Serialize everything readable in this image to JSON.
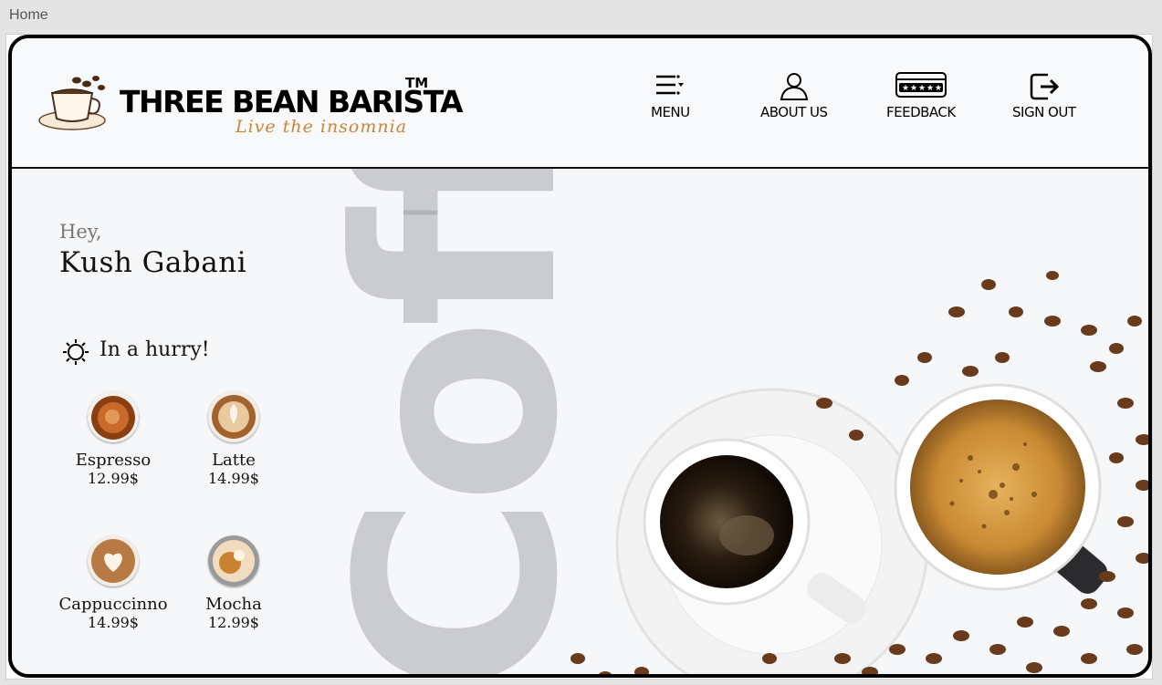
{
  "window": {
    "title": "Home"
  },
  "brand": {
    "name": "THREE BEAN BARISTA",
    "tm": "TM",
    "tagline": "Live the insomnia"
  },
  "nav": [
    {
      "label": "MENU",
      "icon": "menu-icon"
    },
    {
      "label": "ABOUT US",
      "icon": "person-icon"
    },
    {
      "label": "FEEDBACK",
      "icon": "rating-stars-icon"
    },
    {
      "label": "SIGN OUT",
      "icon": "sign-out-icon"
    }
  ],
  "watermark": "Coffee",
  "greeting": {
    "hey": "Hey,",
    "name": "Kush Gabani"
  },
  "quick": {
    "title": "In a hurry!",
    "icon": "sun-icon",
    "products": [
      {
        "name": "Espresso",
        "price": "12.99$"
      },
      {
        "name": "Latte",
        "price": "14.99$"
      },
      {
        "name": "Cappuccinno",
        "price": "14.99$"
      },
      {
        "name": "Mocha",
        "price": "12.99$"
      }
    ]
  },
  "colors": {
    "tagline": "#c98536",
    "text": "#111111",
    "watermark": "#96969b"
  }
}
